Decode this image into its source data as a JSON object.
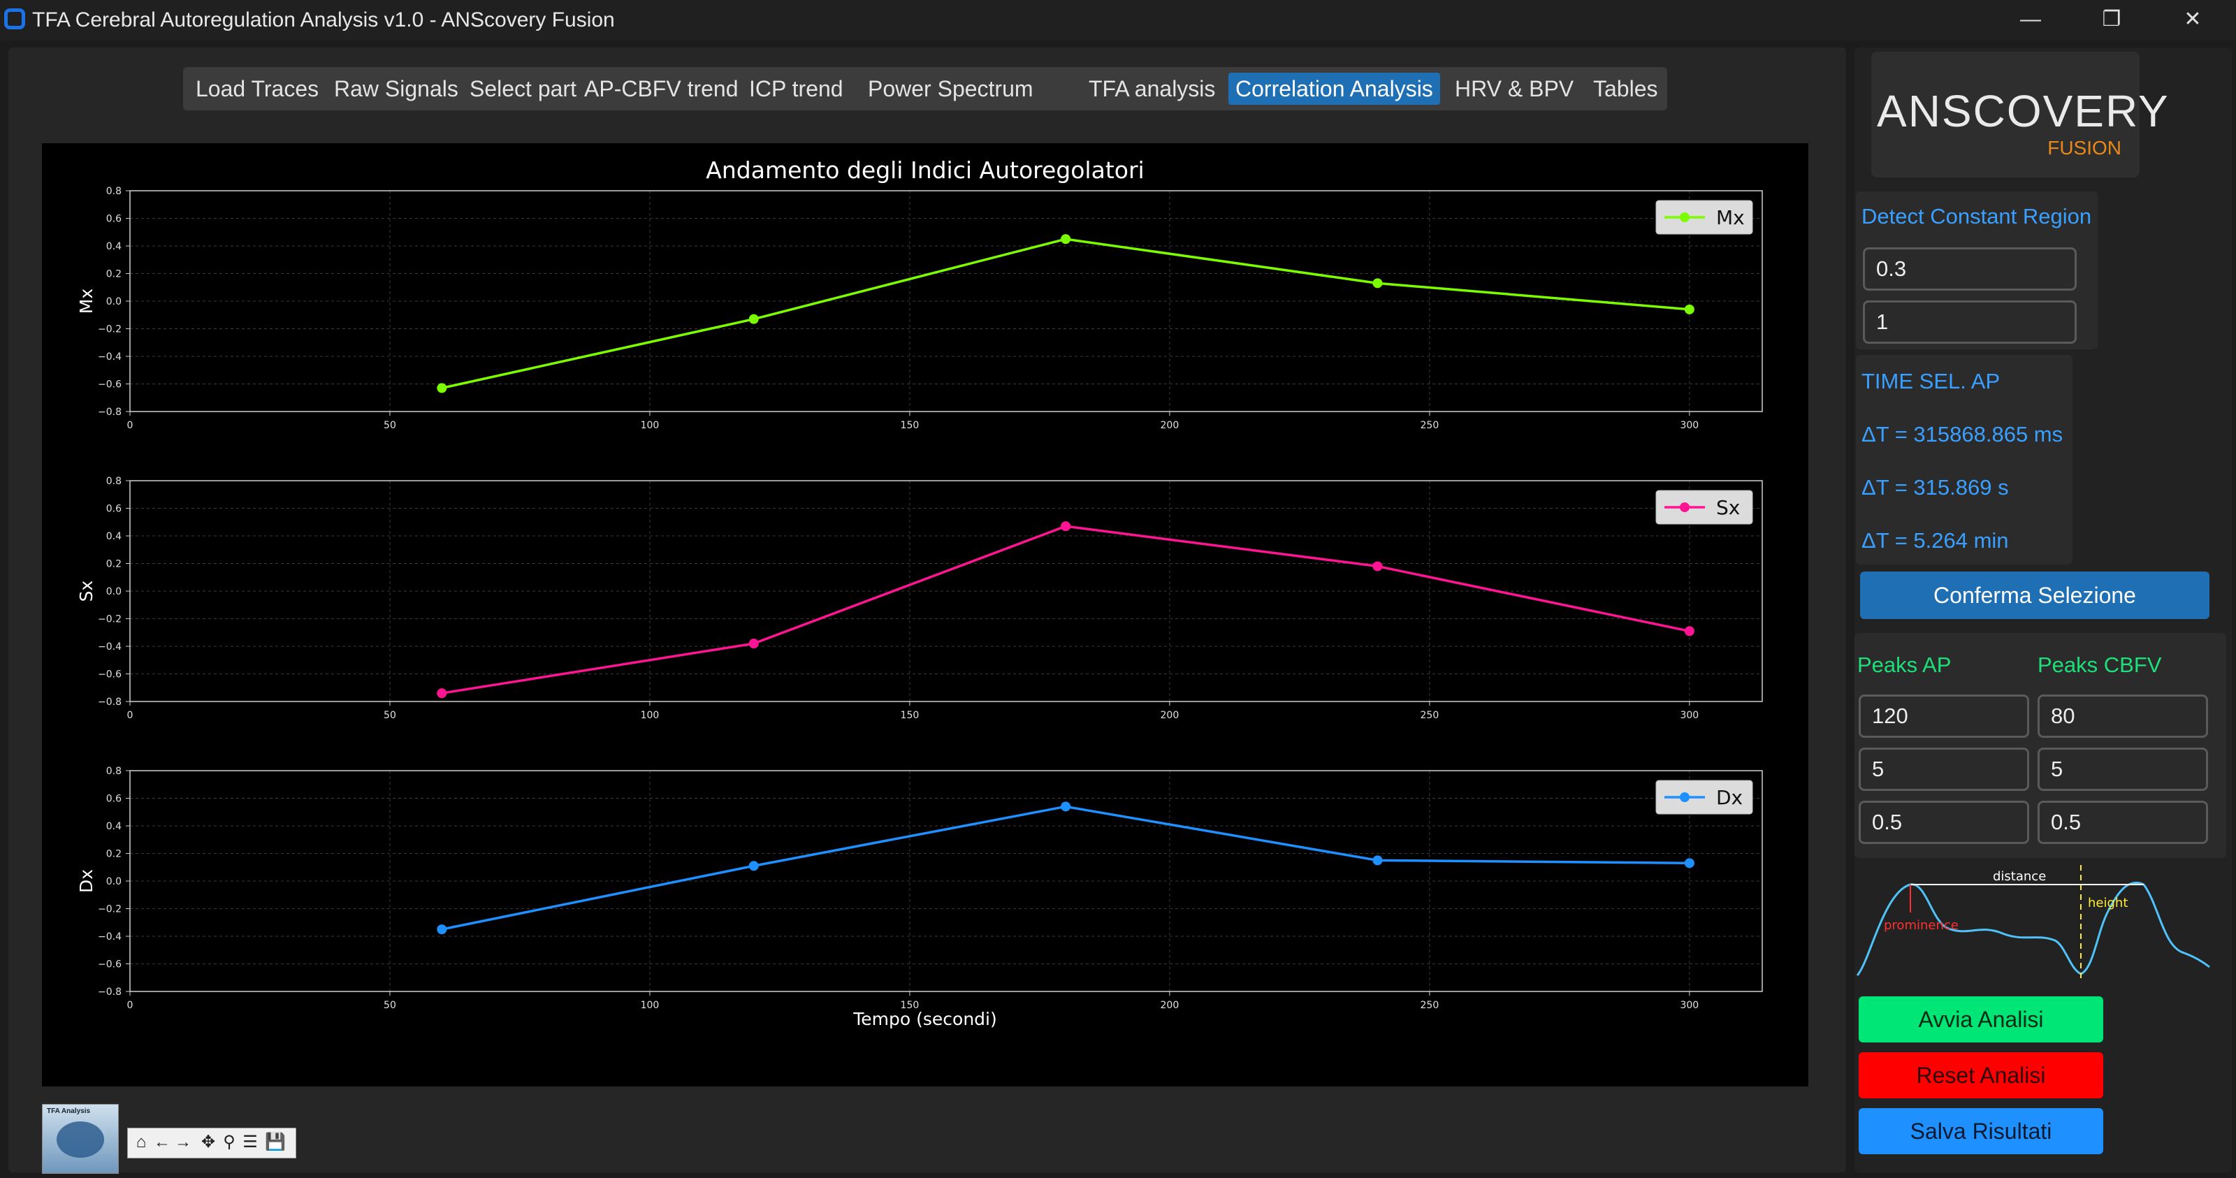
{
  "window": {
    "title": "TFA Cerebral Autoregulation Analysis v1.0 - ANScovery Fusion",
    "controls": {
      "minimize": "—",
      "restore": "❐",
      "close": "✕"
    }
  },
  "tabs": [
    {
      "label": "Load Traces"
    },
    {
      "label": "Raw Signals"
    },
    {
      "label": "Select part"
    },
    {
      "label": "AP-CBFV trend"
    },
    {
      "label": "ICP trend"
    },
    {
      "label": "Power Spectrum"
    },
    {
      "label": "TFA analysis"
    },
    {
      "label": "Correlation Analysis",
      "active": true
    },
    {
      "label": "HRV & BPV"
    },
    {
      "label": "Tables"
    }
  ],
  "plot": {
    "title": "Andamento degli Indici Autoregolatori",
    "xlabel": "Tempo (secondi)"
  },
  "chart_data": {
    "type": "line",
    "title": "Andamento degli Indici Autoregolatori",
    "xlabel": "Tempo (secondi)",
    "xlim": [
      0,
      314
    ],
    "xticks": [
      0,
      50,
      100,
      150,
      200,
      250,
      300
    ],
    "ylim": [
      -0.8,
      0.8
    ],
    "yticks": [
      -0.8,
      -0.6,
      -0.4,
      -0.2,
      0.0,
      0.2,
      0.4,
      0.6,
      0.8
    ],
    "grid": true,
    "legend_position": "top-right",
    "x": [
      60,
      120,
      180,
      240,
      300
    ],
    "series": [
      {
        "name": "Mx",
        "ylabel": "Mx",
        "color": "#7cfc00",
        "values": [
          -0.63,
          -0.13,
          0.45,
          0.13,
          -0.06
        ]
      },
      {
        "name": "Sx",
        "ylabel": "Sx",
        "color": "#ff1493",
        "values": [
          -0.74,
          -0.38,
          0.47,
          0.18,
          -0.29
        ]
      },
      {
        "name": "Dx",
        "ylabel": "Dx",
        "color": "#1e90ff",
        "values": [
          -0.35,
          0.11,
          0.54,
          0.15,
          0.13
        ]
      }
    ]
  },
  "thumbnail": {
    "label": "TFA Analysis"
  },
  "nav_toolbar": {
    "home": "⌂",
    "back": "←",
    "forward": "→",
    "pan": "✥",
    "zoom": "⚲",
    "configure": "☰",
    "save": "💾"
  },
  "sidebar": {
    "logo": {
      "main": "ANSCOVERY",
      "sub": "FUSION"
    },
    "detect_constant_region": {
      "label": "Detect Constant Region",
      "field1": "0.3",
      "field2": "1"
    },
    "time_selection": {
      "label": "TIME SEL. AP",
      "ms": "ΔT = 315868.865 ms",
      "s": "ΔT = 315.869 s",
      "min": "ΔT = 5.264 min"
    },
    "confirm_button": "Conferma Selezione",
    "peaks_ap": {
      "label": "Peaks AP",
      "values": [
        "120",
        "5",
        "0.5"
      ]
    },
    "peaks_cbfv": {
      "label": "Peaks CBFV",
      "values": [
        "80",
        "5",
        "0.5"
      ]
    },
    "peaks_diagram": {
      "distance": "distance",
      "height": "height",
      "prominence": "prominence",
      "curve_color": "#4fc3f7"
    },
    "buttons": {
      "start": {
        "label": "Avvia Analisi",
        "color": "#00e676"
      },
      "reset": {
        "label": "Reset Analisi",
        "color": "#ff0000"
      },
      "save": {
        "label": "Salva Risultati",
        "color": "#1e90ff"
      }
    }
  }
}
